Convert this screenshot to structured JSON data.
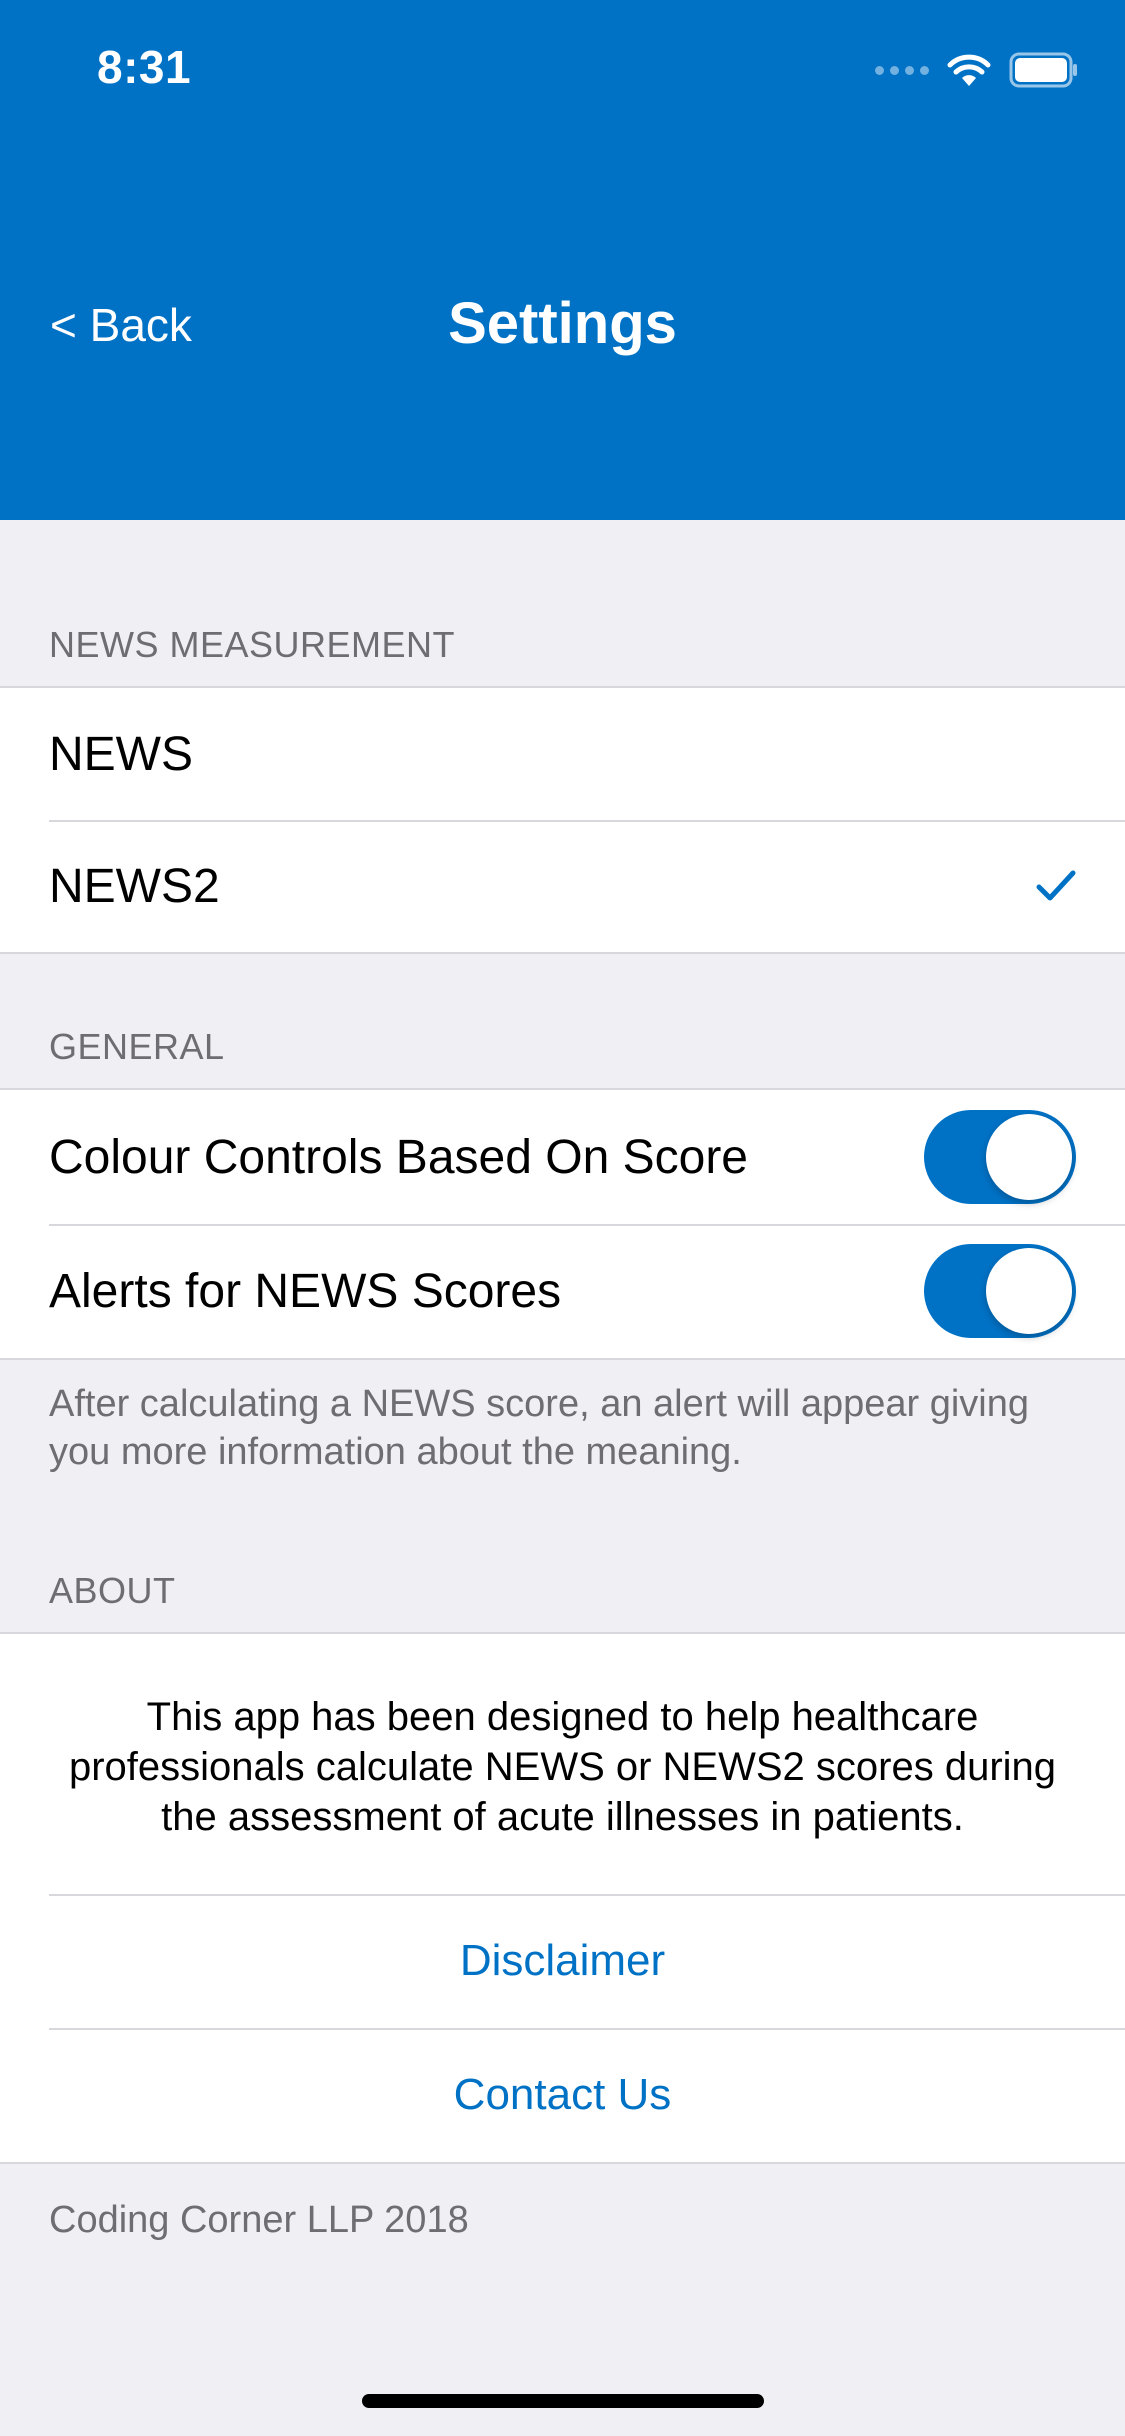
{
  "status_bar": {
    "time": "8:31",
    "icons": [
      "signal-icon",
      "wifi-icon",
      "battery-icon"
    ]
  },
  "nav": {
    "back_label": "< Back",
    "title": "Settings"
  },
  "sections": {
    "measurement": {
      "header": "NEWS MEASUREMENT",
      "options": [
        {
          "label": "NEWS",
          "selected": false
        },
        {
          "label": "NEWS2",
          "selected": true
        }
      ]
    },
    "general": {
      "header": "GENERAL",
      "toggles": [
        {
          "label": "Colour Controls Based On Score",
          "on": true
        },
        {
          "label": "Alerts for NEWS Scores",
          "on": true
        }
      ],
      "footer": "After calculating a NEWS score, an alert will appear giving you more information about the meaning."
    },
    "about": {
      "header": "ABOUT",
      "description": "This app has been designed to help healthcare professionals calculate NEWS or NEWS2 scores during the assessment of acute illnesses in patients.",
      "links": [
        "Disclaimer",
        "Contact Us"
      ],
      "footer": "Coding Corner LLP 2018"
    }
  },
  "colors": {
    "accent": "#0072c6",
    "background": "#efeff4",
    "secondary_text": "#6d6d72"
  }
}
